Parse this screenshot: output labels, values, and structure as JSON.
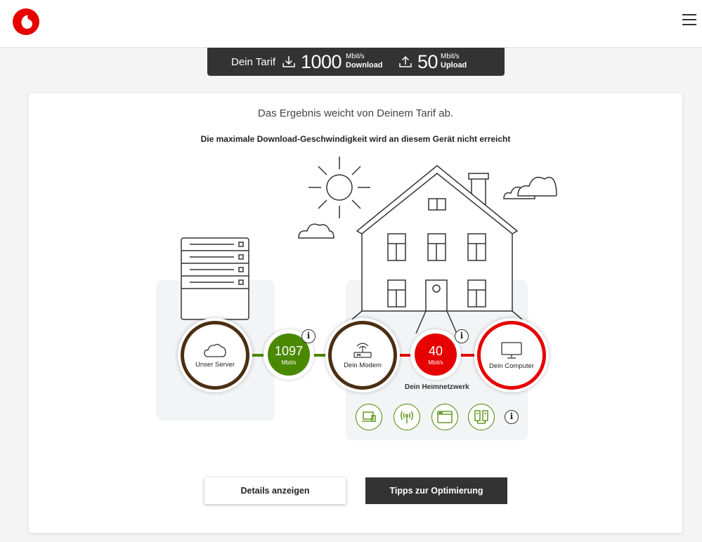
{
  "header": {
    "logo": "vodafone-logo",
    "menu_icon": "hamburger-menu-icon"
  },
  "tariff": {
    "label": "Dein Tarif",
    "download_value": "1000",
    "download_unit": "Mbit/s",
    "download_label": "Download",
    "upload_value": "50",
    "upload_unit": "Mbit/s",
    "upload_label": "Upload"
  },
  "result": {
    "headline": "Das Ergebnis weicht von Deinem Tarif ab.",
    "subline": "Die maximale Download-Geschwindigkeit wird an diesem Gerät nicht erreicht"
  },
  "nodes": {
    "server": "Unser Server",
    "modem": "Dein Modem",
    "computer": "Dein Computer"
  },
  "speeds": {
    "server_modem": {
      "value": "1097",
      "unit": "Mbit/s"
    },
    "modem_computer": {
      "value": "40",
      "unit": "Mbit/s"
    }
  },
  "home_network_label": "Dein Heimnetzwerk",
  "devices": [
    "laptop-icon",
    "wifi-antenna-icon",
    "browser-window-icon",
    "network-device-icon"
  ],
  "buttons": {
    "details": "Details anzeigen",
    "tips": "Tipps zur Optimierung"
  },
  "colors": {
    "brand": "#e60000",
    "ok": "#4a8800",
    "bad": "#e60000",
    "dark": "#333333",
    "ring": "#4a2f12"
  }
}
